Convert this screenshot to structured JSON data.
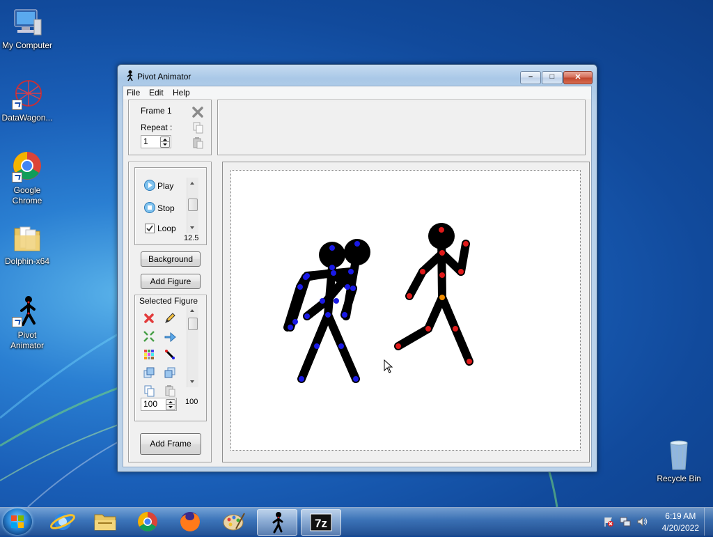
{
  "desktop": {
    "icons": [
      {
        "label": "My Computer"
      },
      {
        "label": "DataWagon..."
      },
      {
        "label": "Google Chrome"
      },
      {
        "label": "Dolphin-x64"
      },
      {
        "label": "Pivot Animator"
      },
      {
        "label": "Recycle Bin"
      }
    ]
  },
  "window": {
    "title": "Pivot Animator",
    "menu": [
      "File",
      "Edit",
      "Help"
    ],
    "frame_panel": {
      "frame_label": "Frame 1",
      "repeat_label": "Repeat :",
      "repeat_value": "1"
    },
    "playback": {
      "play_label": "Play",
      "stop_label": "Stop",
      "loop_label": "Loop",
      "loop_checked": true,
      "speed_value": "12.5"
    },
    "buttons": {
      "background": "Background",
      "add_figure": "Add Figure",
      "add_frame": "Add Frame"
    },
    "selected_figure": {
      "heading": "Selected Figure",
      "size_value": "100",
      "scroll_value": "100"
    }
  },
  "taskbar": {
    "time": "6:19 AM",
    "date": "4/20/2022"
  },
  "colors": {
    "blue_joint": "#1a1ae6",
    "red_joint": "#e01a1a",
    "orange_joint": "#f08c00",
    "figure": "#000000"
  }
}
